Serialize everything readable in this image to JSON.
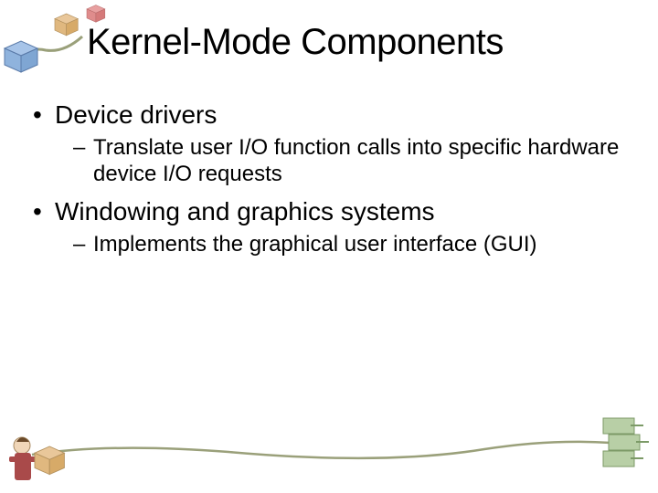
{
  "slide": {
    "title": "Kernel-Mode Components",
    "bullets": [
      {
        "level": 1,
        "text": "Device drivers"
      },
      {
        "level": 2,
        "text": "Translate user I/O function calls into specific hardware device I/O requests"
      },
      {
        "level": 1,
        "text": "Windowing and graphics systems"
      },
      {
        "level": 2,
        "text": "Implements the graphical user interface (GUI)"
      }
    ]
  }
}
